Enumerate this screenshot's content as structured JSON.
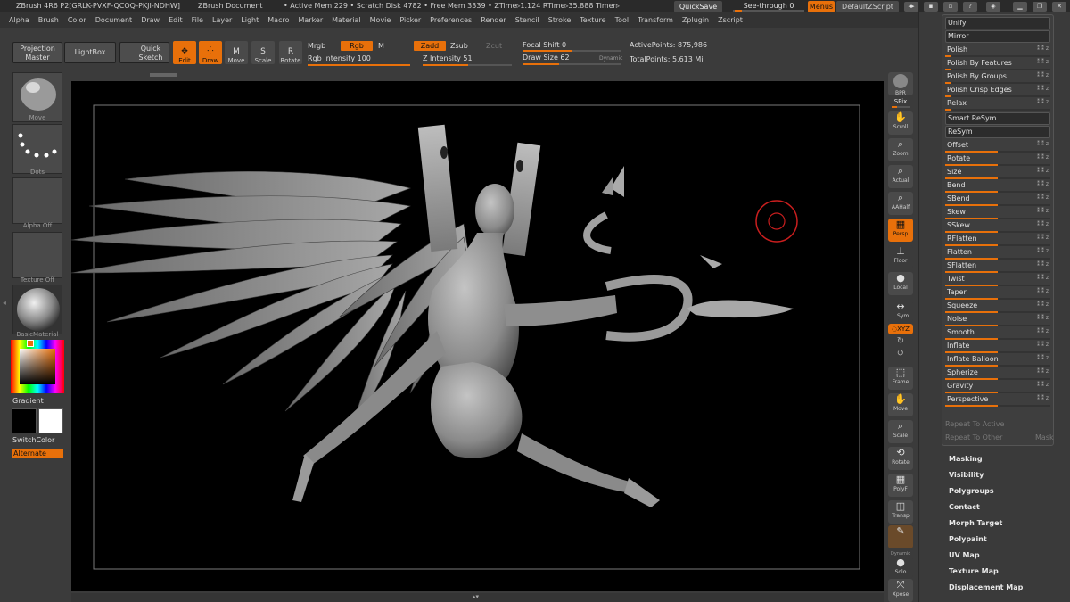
{
  "titlebar": {
    "app": "ZBrush 4R6 P2[GRLK-PVXF-QCOQ-PKJI-NDHW]",
    "doc": "ZBrush Document",
    "stats": "• Active Mem 229 • Scratch Disk 4782 • Free Mem 3339 • ZTime▹1.124 RTime▹35.888 Timer▹",
    "quicksave": "QuickSave",
    "seethrough": "See-through  0",
    "seethrough_value": 0,
    "menus": "Menus",
    "default_zscript": "DefaultZScript"
  },
  "menubar": [
    "Alpha",
    "Brush",
    "Color",
    "Document",
    "Draw",
    "Edit",
    "File",
    "Layer",
    "Light",
    "Macro",
    "Marker",
    "Material",
    "Movie",
    "Picker",
    "Preferences",
    "Render",
    "Stencil",
    "Stroke",
    "Texture",
    "Tool",
    "Transform",
    "Zplugin",
    "Zscript"
  ],
  "toolbar": {
    "projection_master": "Projection Master",
    "lightbox": "LightBox",
    "quick_sketch": "Quick Sketch",
    "edit": "Edit",
    "draw": "Draw",
    "move": "Move",
    "scale": "Scale",
    "rotate": "Rotate",
    "mrgb": "Mrgb",
    "rgb": "Rgb",
    "m": "M",
    "rgb_intensity": "Rgb Intensity 100",
    "rgb_intensity_value": 100,
    "zadd": "Zadd",
    "zsub": "Zsub",
    "zcut": "Zcut",
    "z_intensity": "Z Intensity 51",
    "z_intensity_value": 51,
    "focal_shift": "Focal Shift 0",
    "focal_shift_value": 0,
    "draw_size": "Draw Size 62",
    "draw_size_value": 62,
    "dynamic": "Dynamic",
    "active_points": "ActivePoints: 875,986",
    "total_points": "TotalPoints: 5.613 Mil"
  },
  "leftshelf": {
    "brush_label": "Move",
    "stroke_label": "Dots",
    "alpha_label": "Alpha  Off",
    "texture_label": "Texture  Off",
    "material_label": "BasicMaterial",
    "gradient": "Gradient",
    "switchcolor": "SwitchColor",
    "alternate": "Alternate"
  },
  "rightshelf": {
    "bpr": "BPR",
    "spix": "SPix",
    "scroll": "Scroll",
    "zoom": "Zoom",
    "actual": "Actual",
    "aahalf": "AAHalf",
    "persp": "Persp",
    "floor": "Floor",
    "local": "Local",
    "lsym": "L.Sym",
    "xyz": "◌XYZ",
    "frame": "Frame",
    "move": "Move",
    "scale": "Scale",
    "rotate": "Rotate",
    "polyf": "PolyF",
    "transp": "Transp",
    "dynamic": "Dynamic",
    "solo": "Solo",
    "xpose": "Xpose"
  },
  "deformation": [
    {
      "label": "Unify",
      "kind": "box"
    },
    {
      "label": "Mirror",
      "kind": "box"
    },
    {
      "label": "Polish",
      "kind": "slider",
      "value": 0
    },
    {
      "label": "Polish By Features",
      "kind": "slider",
      "value": 0
    },
    {
      "label": "Polish By Groups",
      "kind": "slider",
      "value": 0
    },
    {
      "label": "Polish Crisp Edges",
      "kind": "slider",
      "value": 0
    },
    {
      "label": "Relax",
      "kind": "slider",
      "value": 0
    },
    {
      "label": "Smart ReSym",
      "kind": "box"
    },
    {
      "label": "ReSym",
      "kind": "box"
    },
    {
      "label": "Offset",
      "kind": "slider",
      "value": 50
    },
    {
      "label": "Rotate",
      "kind": "slider",
      "value": 50
    },
    {
      "label": "Size",
      "kind": "slider",
      "value": 50
    },
    {
      "label": "Bend",
      "kind": "slider",
      "value": 50
    },
    {
      "label": "SBend",
      "kind": "slider",
      "value": 50
    },
    {
      "label": "Skew",
      "kind": "slider",
      "value": 50
    },
    {
      "label": "SSkew",
      "kind": "slider",
      "value": 50
    },
    {
      "label": "RFlatten",
      "kind": "slider",
      "value": 50
    },
    {
      "label": "Flatten",
      "kind": "slider",
      "value": 50
    },
    {
      "label": "SFlatten",
      "kind": "slider",
      "value": 50
    },
    {
      "label": "Twist",
      "kind": "slider",
      "value": 50
    },
    {
      "label": "Taper",
      "kind": "slider",
      "value": 50
    },
    {
      "label": "Squeeze",
      "kind": "slider",
      "value": 50
    },
    {
      "label": "Noise",
      "kind": "slider",
      "value": 50
    },
    {
      "label": "Smooth",
      "kind": "slider",
      "value": 50
    },
    {
      "label": "Inflate",
      "kind": "slider",
      "value": 50
    },
    {
      "label": "Inflate Balloon",
      "kind": "slider",
      "value": 50
    },
    {
      "label": "Spherize",
      "kind": "slider",
      "value": 50
    },
    {
      "label": "Gravity",
      "kind": "slider",
      "value": 50
    },
    {
      "label": "Perspective",
      "kind": "slider",
      "value": 50
    }
  ],
  "repeat_to_active": "Repeat To Active",
  "repeat_to_other": "Repeat To Other",
  "mask": "Mask",
  "sections": [
    "Masking",
    "Visibility",
    "Polygroups",
    "Contact",
    "Morph Target",
    "Polypaint",
    "UV Map",
    "Texture Map",
    "Displacement Map"
  ],
  "colors": {
    "accent": "#e8700a",
    "panel": "#3b3b3b",
    "canvas": "#000000",
    "cursor": "#c81e1e"
  },
  "icons": {
    "persp": "grid-icon",
    "local": "sphere-icon",
    "xyz": "axis-icon",
    "bpr": "sphere-icon"
  }
}
